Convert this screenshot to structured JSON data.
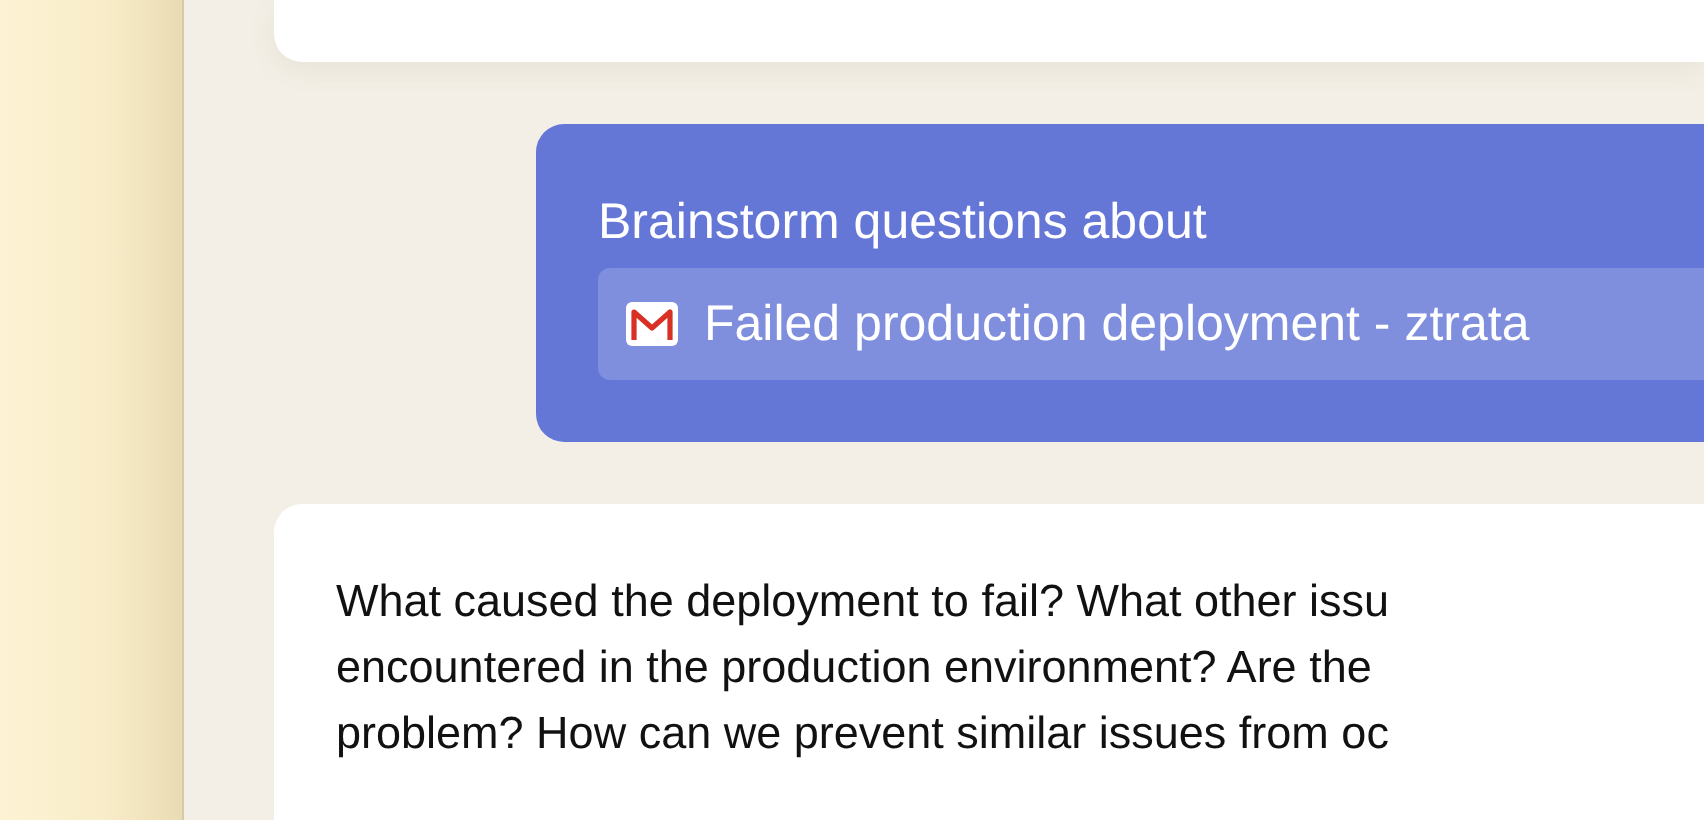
{
  "prompt": {
    "heading": "Brainstorm questions about",
    "attachment": {
      "kind": "email",
      "title": "Failed production deployment - ztrata"
    }
  },
  "response": {
    "lines": [
      "What caused the deployment to fail? What other issu",
      "encountered in the production environment? Are the",
      "problem? How can we prevent similar issues from oc"
    ]
  }
}
